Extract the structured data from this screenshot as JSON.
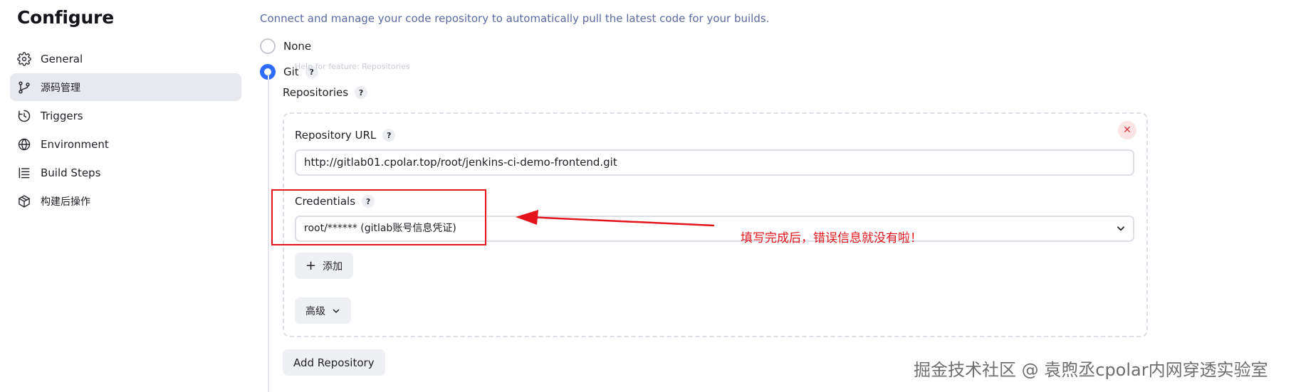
{
  "page": {
    "title": "Configure"
  },
  "sidebar": {
    "items": [
      {
        "label": "General",
        "icon": "gear-icon",
        "active": false
      },
      {
        "label": "源码管理",
        "icon": "branch-icon",
        "active": true
      },
      {
        "label": "Triggers",
        "icon": "clock-icon",
        "active": false
      },
      {
        "label": "Environment",
        "icon": "globe-icon",
        "active": false
      },
      {
        "label": "Build Steps",
        "icon": "list-icon",
        "active": false
      },
      {
        "label": "构建后操作",
        "icon": "package-icon",
        "active": false
      }
    ]
  },
  "scm": {
    "description": "Connect and manage your code repository to automatically pull the latest code for your builds.",
    "options": {
      "none_label": "None",
      "git_label": "Git",
      "selected": "Git"
    },
    "help_symbol": "?",
    "tooltip_ghost": "Help for feature: Repositories",
    "repositories_label": "Repositories",
    "repository": {
      "url_label": "Repository URL",
      "url_value": "http://gitlab01.cpolar.top/root/jenkins-ci-demo-frontend.git",
      "credentials_label": "Credentials",
      "credentials_value": "root/****** (gitlab账号信息凭证)",
      "add_label": "添加",
      "advanced_label": "高级",
      "delete_symbol": "✕"
    },
    "add_repository_label": "Add Repository"
  },
  "annotation": {
    "text": "填写完成后，错误信息就没有啦！",
    "color": "#e3141b"
  },
  "watermark": {
    "text": "掘金技术社区 @ 袁煦丞cpolar内网穿透实验室"
  },
  "colors": {
    "accent": "#2f6bff",
    "active_nav_bg": "#e8e9ef",
    "description_text": "#5a6aa0",
    "danger": "#d9363e"
  }
}
